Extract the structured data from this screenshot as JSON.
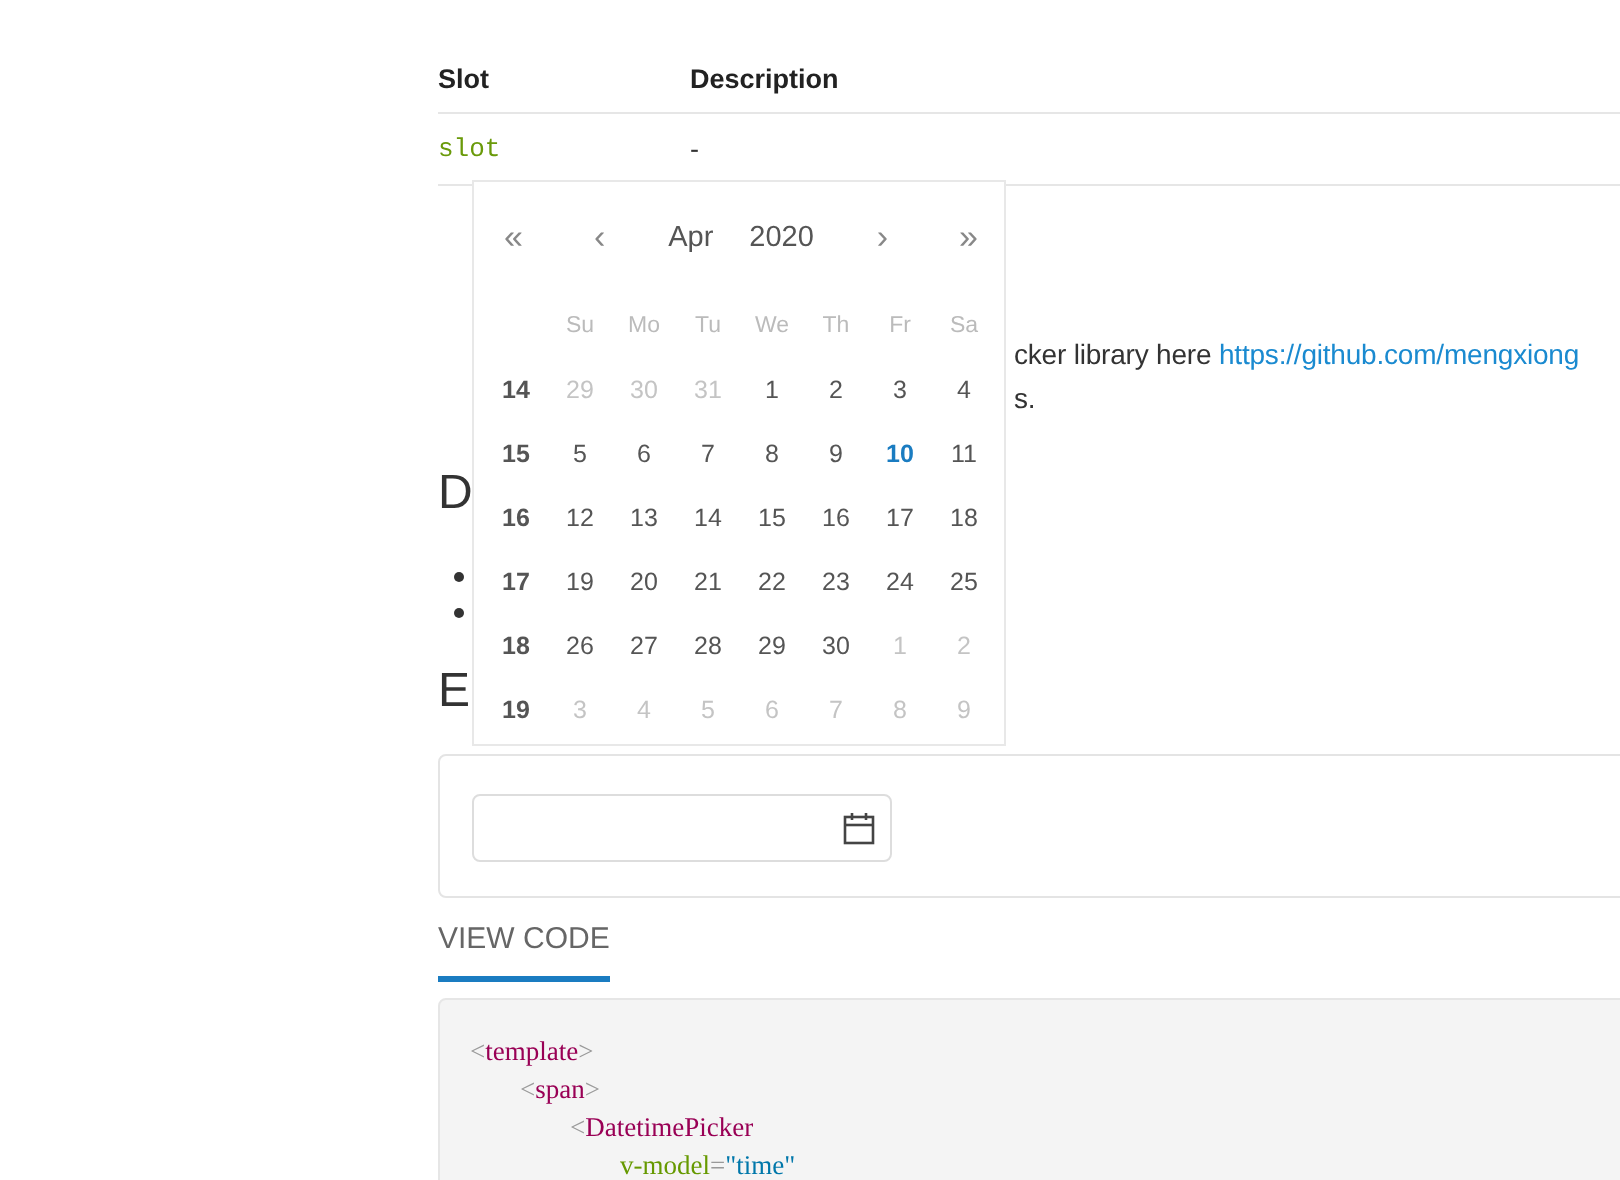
{
  "slots_table": {
    "columns": [
      "Slot",
      "Description"
    ],
    "rows": [
      [
        "slot",
        "-"
      ]
    ]
  },
  "intro": {
    "text": "cker library here ",
    "link": "https://github.com/mengxiong",
    "line2": "s."
  },
  "heading_1": "D",
  "heading_2": "E",
  "example": {
    "calendar": {
      "nav": {
        "prev_year": "«",
        "prev_month": "‹",
        "month": "Apr",
        "year": "2020",
        "next_month": "›",
        "next_year": "»"
      },
      "weekdays": [
        "Su",
        "Mo",
        "Tu",
        "We",
        "Th",
        "Fr",
        "Sa"
      ],
      "weeks": [
        {
          "week": "14",
          "days": [
            {
              "d": "29",
              "muted": true,
              "selected": false
            },
            {
              "d": "30",
              "muted": true,
              "selected": false
            },
            {
              "d": "31",
              "muted": true,
              "selected": false
            },
            {
              "d": "1",
              "muted": false,
              "selected": false
            },
            {
              "d": "2",
              "muted": false,
              "selected": false
            },
            {
              "d": "3",
              "muted": false,
              "selected": false
            },
            {
              "d": "4",
              "muted": false,
              "selected": false
            }
          ]
        },
        {
          "week": "15",
          "days": [
            {
              "d": "5",
              "muted": false,
              "selected": false
            },
            {
              "d": "6",
              "muted": false,
              "selected": false
            },
            {
              "d": "7",
              "muted": false,
              "selected": false
            },
            {
              "d": "8",
              "muted": false,
              "selected": false
            },
            {
              "d": "9",
              "muted": false,
              "selected": false
            },
            {
              "d": "10",
              "muted": false,
              "selected": true
            },
            {
              "d": "11",
              "muted": false,
              "selected": false
            }
          ]
        },
        {
          "week": "16",
          "days": [
            {
              "d": "12",
              "muted": false,
              "selected": false
            },
            {
              "d": "13",
              "muted": false,
              "selected": false
            },
            {
              "d": "14",
              "muted": false,
              "selected": false
            },
            {
              "d": "15",
              "muted": false,
              "selected": false
            },
            {
              "d": "16",
              "muted": false,
              "selected": false
            },
            {
              "d": "17",
              "muted": false,
              "selected": false
            },
            {
              "d": "18",
              "muted": false,
              "selected": false
            }
          ]
        },
        {
          "week": "17",
          "days": [
            {
              "d": "19",
              "muted": false,
              "selected": false
            },
            {
              "d": "20",
              "muted": false,
              "selected": false
            },
            {
              "d": "21",
              "muted": false,
              "selected": false
            },
            {
              "d": "22",
              "muted": false,
              "selected": false
            },
            {
              "d": "23",
              "muted": false,
              "selected": false
            },
            {
              "d": "24",
              "muted": false,
              "selected": false
            },
            {
              "d": "25",
              "muted": false,
              "selected": false
            }
          ]
        },
        {
          "week": "18",
          "days": [
            {
              "d": "26",
              "muted": false,
              "selected": false
            },
            {
              "d": "27",
              "muted": false,
              "selected": false
            },
            {
              "d": "28",
              "muted": false,
              "selected": false
            },
            {
              "d": "29",
              "muted": false,
              "selected": false
            },
            {
              "d": "30",
              "muted": false,
              "selected": false
            },
            {
              "d": "1",
              "muted": true,
              "selected": false
            },
            {
              "d": "2",
              "muted": true,
              "selected": false
            }
          ]
        },
        {
          "week": "19",
          "days": [
            {
              "d": "3",
              "muted": true,
              "selected": false
            },
            {
              "d": "4",
              "muted": true,
              "selected": false
            },
            {
              "d": "5",
              "muted": true,
              "selected": false
            },
            {
              "d": "6",
              "muted": true,
              "selected": false
            },
            {
              "d": "7",
              "muted": true,
              "selected": false
            },
            {
              "d": "8",
              "muted": true,
              "selected": false
            },
            {
              "d": "9",
              "muted": true,
              "selected": false
            }
          ]
        }
      ]
    }
  },
  "view_code_tab": {
    "label": "VIEW CODE",
    "selected": true
  },
  "code": [
    {
      "tokens": [
        {
          "kind": "punct",
          "text": "<"
        },
        {
          "kind": "tag",
          "text": "template"
        },
        {
          "kind": "punct",
          "text": ">"
        }
      ],
      "children": [
        {
          "tokens": [
            {
              "kind": "punct",
              "text": "<"
            },
            {
              "kind": "tag",
              "text": "span"
            },
            {
              "kind": "punct",
              "text": ">"
            }
          ],
          "children": [
            {
              "tokens": [
                {
                  "kind": "punct",
                  "text": "<"
                },
                {
                  "kind": "tag",
                  "text": "DatetimePicker"
                }
              ],
              "children": [
                {
                  "tokens": [
                    {
                      "kind": "attr",
                      "text": "v-model"
                    },
                    {
                      "kind": "punct",
                      "text": "="
                    },
                    {
                      "kind": "value",
                      "text": "\"time\""
                    }
                  ]
                }
              ]
            }
          ]
        }
      ]
    }
  ]
}
